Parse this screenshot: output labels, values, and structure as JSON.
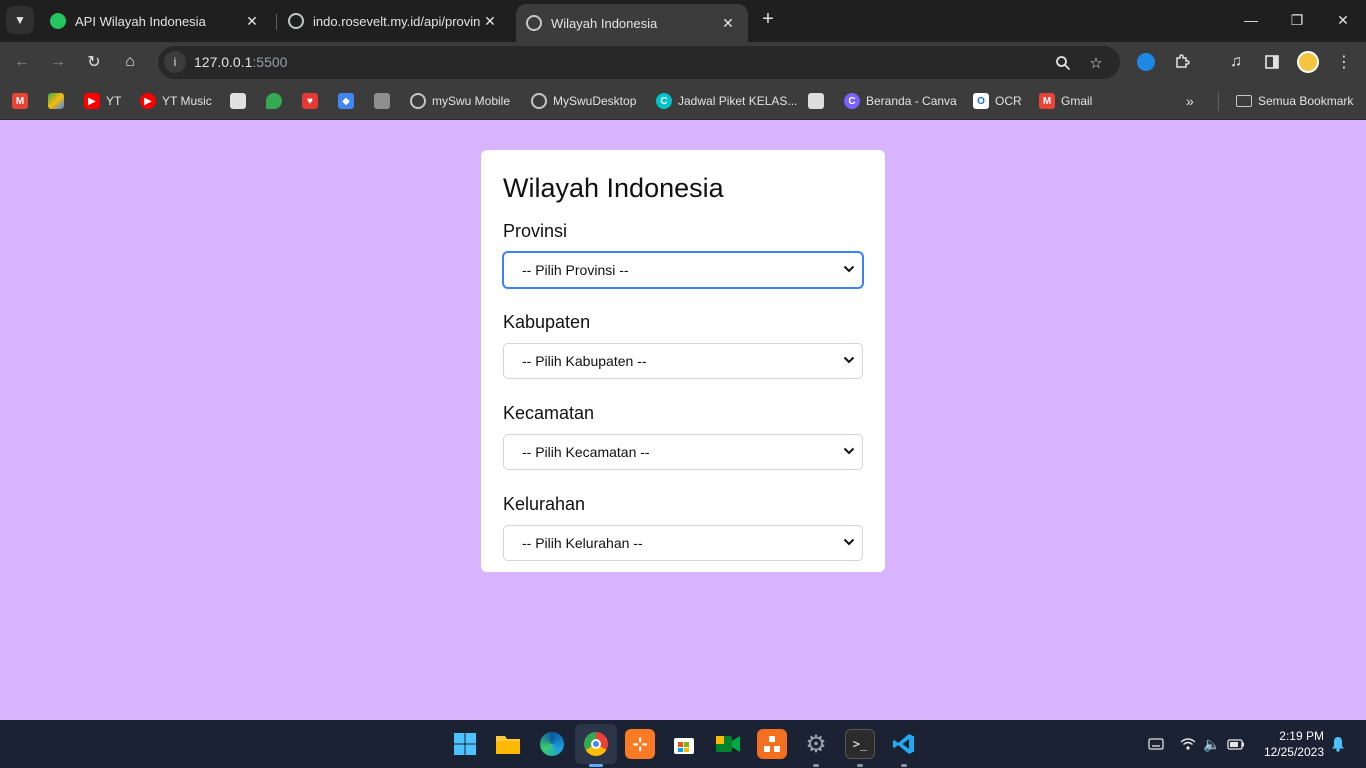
{
  "browser": {
    "tabs": [
      {
        "title": "API Wilayah Indonesia",
        "active": false,
        "favicon": "green-globe-icon"
      },
      {
        "title": "indo.rosevelt.my.id/api/provinsi",
        "active": false,
        "favicon": "globe-icon"
      },
      {
        "title": "Wilayah Indonesia",
        "active": true,
        "favicon": "globe-icon"
      }
    ],
    "address": {
      "host": "127.0.0.1",
      "port": ":5500"
    },
    "bookmarks": [
      {
        "label": "",
        "icon": "gmail-icon"
      },
      {
        "label": "",
        "icon": "drive-icon"
      },
      {
        "label": "YT",
        "icon": "youtube-icon"
      },
      {
        "label": "YT Music",
        "icon": "youtube-music-icon"
      },
      {
        "label": "",
        "icon": "photo-icon"
      },
      {
        "label": "",
        "icon": "maps-icon"
      },
      {
        "label": "",
        "icon": "heart-icon"
      },
      {
        "label": "",
        "icon": "diamond-icon"
      },
      {
        "label": "",
        "icon": "stack-icon"
      },
      {
        "label": "mySwu Mobile",
        "icon": "globe-icon"
      },
      {
        "label": "MySwuDesktop",
        "icon": "globe-icon"
      },
      {
        "label": "Jadwal Piket KELAS...",
        "icon": "canva-icon"
      },
      {
        "label": "",
        "icon": "photo-icon"
      },
      {
        "label": "Beranda - Canva",
        "icon": "canva-icon"
      },
      {
        "label": "OCR",
        "icon": "ocr-icon"
      },
      {
        "label": "Gmail",
        "icon": "gmail-icon"
      }
    ],
    "all_bookmarks": "Semua Bookmark"
  },
  "page": {
    "title": "Wilayah Indonesia",
    "fields": [
      {
        "label": "Provinsi",
        "placeholder": "-- Pilih Provinsi --",
        "focused": true
      },
      {
        "label": "Kabupaten",
        "placeholder": "-- Pilih Kabupaten --",
        "focused": false
      },
      {
        "label": "Kecamatan",
        "placeholder": "-- Pilih Kecamatan --",
        "focused": false
      },
      {
        "label": "Kelurahan",
        "placeholder": "-- Pilih Kelurahan --",
        "focused": false
      }
    ]
  },
  "taskbar": {
    "time": "2:19 PM",
    "date": "12/25/2023"
  },
  "colors": {
    "page_background": "#d8b4fe",
    "focus_ring": "#3b82f6"
  }
}
